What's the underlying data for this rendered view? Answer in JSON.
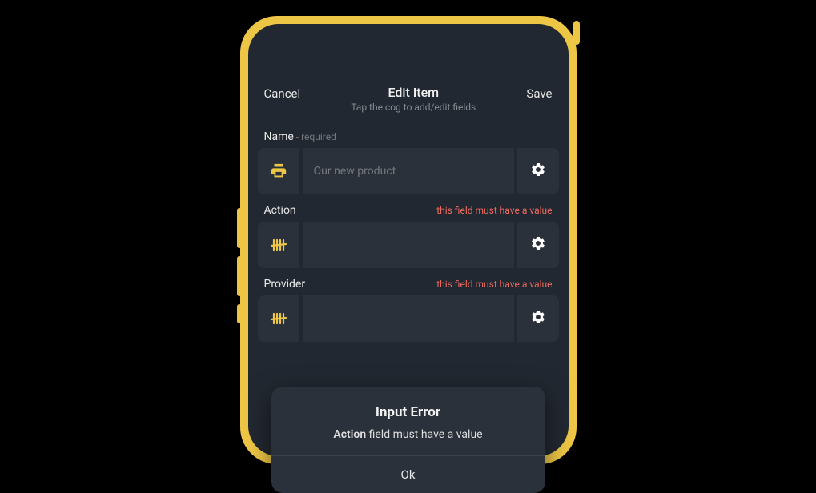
{
  "header": {
    "cancel": "Cancel",
    "title": "Edit Item",
    "subtitle": "Tap the cog to add/edit fields",
    "save": "Save"
  },
  "fields": {
    "name": {
      "label": "Name",
      "required_text": " - required",
      "value": "Our new product",
      "icon": "printer-icon"
    },
    "action": {
      "label": "Action",
      "error": "this field must have a value",
      "value": "",
      "icon": "tally-icon"
    },
    "provider": {
      "label": "Provider",
      "error": "this field must have a value",
      "value": "",
      "icon": "tally-icon"
    }
  },
  "modal": {
    "title": "Input Error",
    "field_name": "Action",
    "message_rest": " field must have a value",
    "ok": "Ok"
  },
  "colors": {
    "frame": "#edc645",
    "screen": "#222831",
    "panel": "#2b313a",
    "error": "#ee6a5e",
    "accent_icon": "#edc645"
  }
}
